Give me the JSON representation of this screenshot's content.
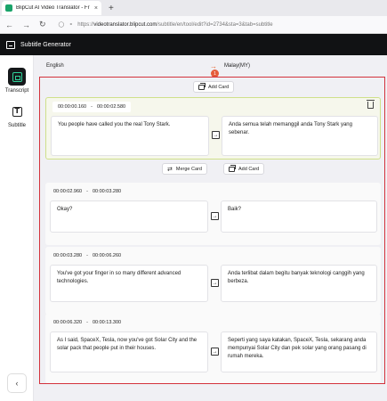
{
  "browser": {
    "tab_title": "BlipCut AI Video Translator - Fr",
    "tab_close": "×",
    "new_tab": "+",
    "url_prefix": "https://",
    "url_host": "videotranslator.blipcut.com",
    "url_path": "/subtitle/en/tool/edit?id=2734&sta=3&tab=subtitle"
  },
  "app": {
    "title": "Subtitle Generator"
  },
  "sidebar": {
    "items": [
      {
        "label": "Transcript",
        "active": true
      },
      {
        "label": "Subtitle",
        "active": false
      }
    ],
    "collapse": "‹"
  },
  "languages": {
    "source": "English",
    "target": "Malay(MY)",
    "arrow": "→",
    "badge": "1"
  },
  "actions": {
    "add_card": "Add Card",
    "merge_card": "Merge Card"
  },
  "cards": [
    {
      "start": "00:00:00.160",
      "sep": "-",
      "end": "00:00:02.580",
      "source": "You people have called you the real Tony Stark.",
      "target": "Anda semua telah memanggil anda Tony Stark yang sebenar."
    },
    {
      "start": "00:00:02.960",
      "sep": "-",
      "end": "00:00:03.280",
      "source": "Okay?",
      "target": "Baik?"
    },
    {
      "start": "00:00:03.280",
      "sep": "-",
      "end": "00:00:06.260",
      "source": "You've got your finger in so many different advanced technologies.",
      "target": "Anda terlibat dalam begitu banyak teknologi canggih yang berbeza."
    },
    {
      "start": "00:00:06.320",
      "sep": "-",
      "end": "00:00:13.300",
      "source": "As I said, SpaceX, Tesla, now you've got Solar City and the solar pack that people put in their houses.",
      "target": "Seperti yang saya katakan, SpaceX, Tesla, sekarang anda mempunyai Solar City dan pek solar yang orang pasang di rumah mereka."
    }
  ]
}
